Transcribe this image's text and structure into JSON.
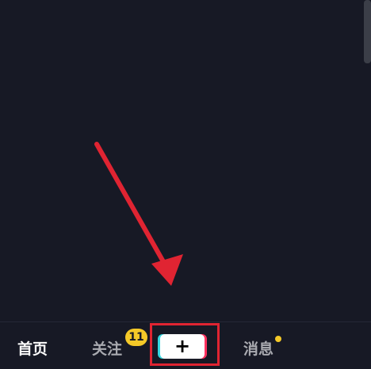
{
  "bottom_nav": {
    "home_label": "首页",
    "follow_label": "关注",
    "follow_badge": "11",
    "create_label": "+",
    "messages_label": "消息"
  },
  "icons": {
    "scrollbar": "scrollbar",
    "create": "plus-icon",
    "arrow": "red-arrow-icon"
  },
  "colors": {
    "background": "#171925",
    "accent_red": "#e02432",
    "badge_yellow": "#f5c928",
    "plus_cyan": "#36d7e0",
    "plus_pink": "#ff315f"
  }
}
